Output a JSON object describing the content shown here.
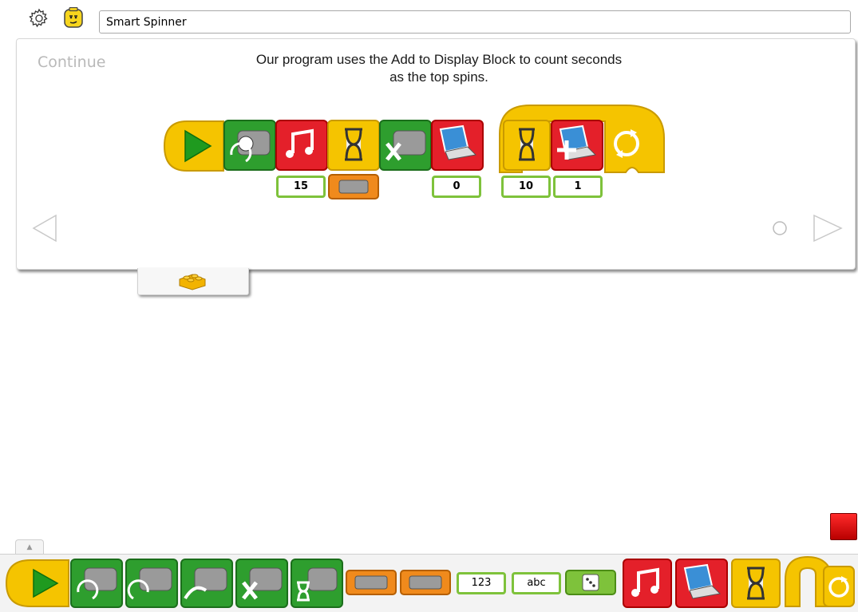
{
  "header": {
    "project_title": "Smart Spinner"
  },
  "panel": {
    "continue_label": "Continue",
    "instruction_line1": "Our program uses the Add to Display Block to count seconds",
    "instruction_line2": "as the top spins."
  },
  "program": {
    "blocks": [
      "start-block",
      "motor-this-way-block",
      "play-sound-block",
      "wait-for-block",
      "motor-off-block",
      "display-block",
      "wait-for-block",
      "add-to-display-block",
      "repeat-block"
    ],
    "sound_value": "15",
    "display_value": "0",
    "wait_value": "10",
    "add_value": "1"
  },
  "palette": {
    "number_label": "123",
    "text_label": "abc",
    "blocks": [
      "start-block",
      "motor-this-way-block",
      "motor-that-way-block",
      "motor-power-block",
      "motor-off-block",
      "motor-on-for-block",
      "tilt-sensor-input",
      "distance-sensor-input",
      "number-input",
      "text-input",
      "random-input",
      "play-sound-block",
      "display-block",
      "wait-for-block",
      "repeat-block"
    ]
  },
  "colors": {
    "start_yellow": "#f5c400",
    "motor_green": "#2e9e2e",
    "sound_red": "#e4202a",
    "sensor_orange": "#f08a1c",
    "input_green": "#7ec23b",
    "stop_red": "#e00000"
  }
}
